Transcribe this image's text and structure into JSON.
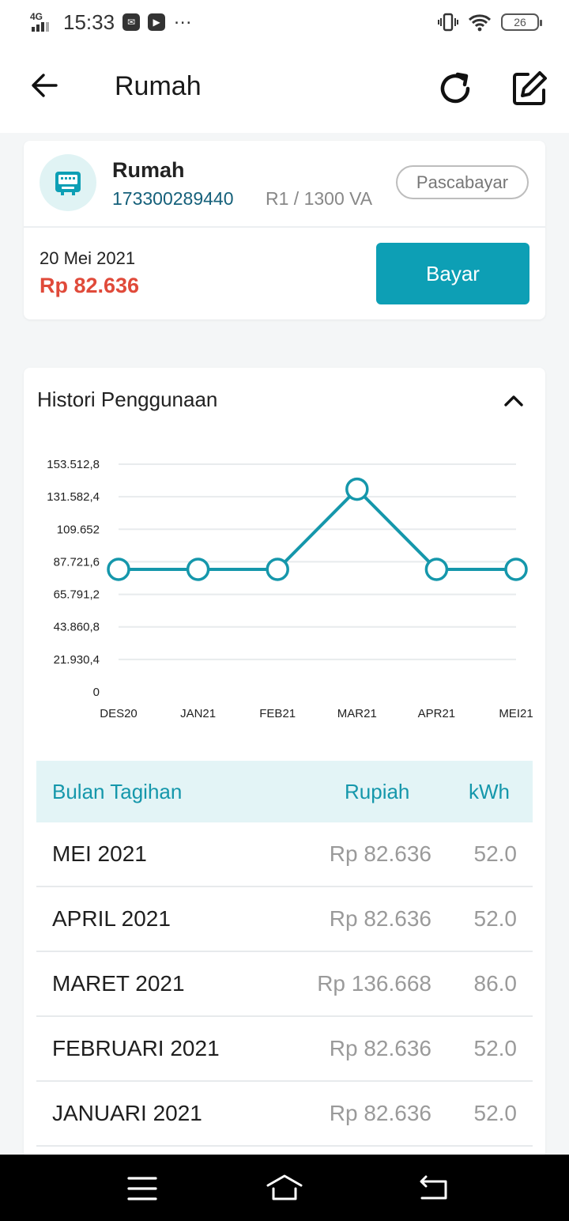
{
  "status_bar": {
    "network": "4G",
    "time": "15:33",
    "battery": "26"
  },
  "app_bar": {
    "title": "Rumah",
    "icons": [
      "back-arrow-icon",
      "refresh-icon",
      "edit-icon"
    ]
  },
  "meter": {
    "name": "Rumah",
    "id": "173300289440",
    "tariff": "R1 / 1300 VA",
    "type": "Pascabayar",
    "bill_date": "20 Mei 2021",
    "bill_amount": "Rp 82.636",
    "pay_label": "Bayar"
  },
  "history": {
    "title": "Histori Penggunaan",
    "table": {
      "headers": [
        "Bulan Tagihan",
        "Rupiah",
        "kWh"
      ],
      "rows": [
        [
          "MEI 2021",
          "Rp 82.636",
          "52.0"
        ],
        [
          "APRIL 2021",
          "Rp 82.636",
          "52.0"
        ],
        [
          "MARET 2021",
          "Rp 136.668",
          "86.0"
        ],
        [
          "FEBRUARI 2021",
          "Rp 82.636",
          "52.0"
        ],
        [
          "JANUARI 2021",
          "Rp 82.636",
          "52.0"
        ]
      ]
    }
  },
  "chart_data": {
    "type": "line",
    "categories": [
      "DES20",
      "JAN21",
      "FEB21",
      "MAR21",
      "APR21",
      "MEI21"
    ],
    "series": [
      {
        "values": [
          82636,
          82636,
          82636,
          136668,
          82636,
          82636
        ]
      }
    ],
    "y_ticks": [
      "0",
      "21.930,4",
      "43.860,8",
      "65.791,2",
      "87.721,6",
      "109.652",
      "131.582,4",
      "153.512,8"
    ],
    "ylim": [
      0,
      153512.8
    ],
    "grid": true,
    "color": "#1597ab"
  },
  "colors": {
    "accent": "#0d9fb5",
    "amount_red": "#e04a3a",
    "id_blue": "#15607a"
  }
}
